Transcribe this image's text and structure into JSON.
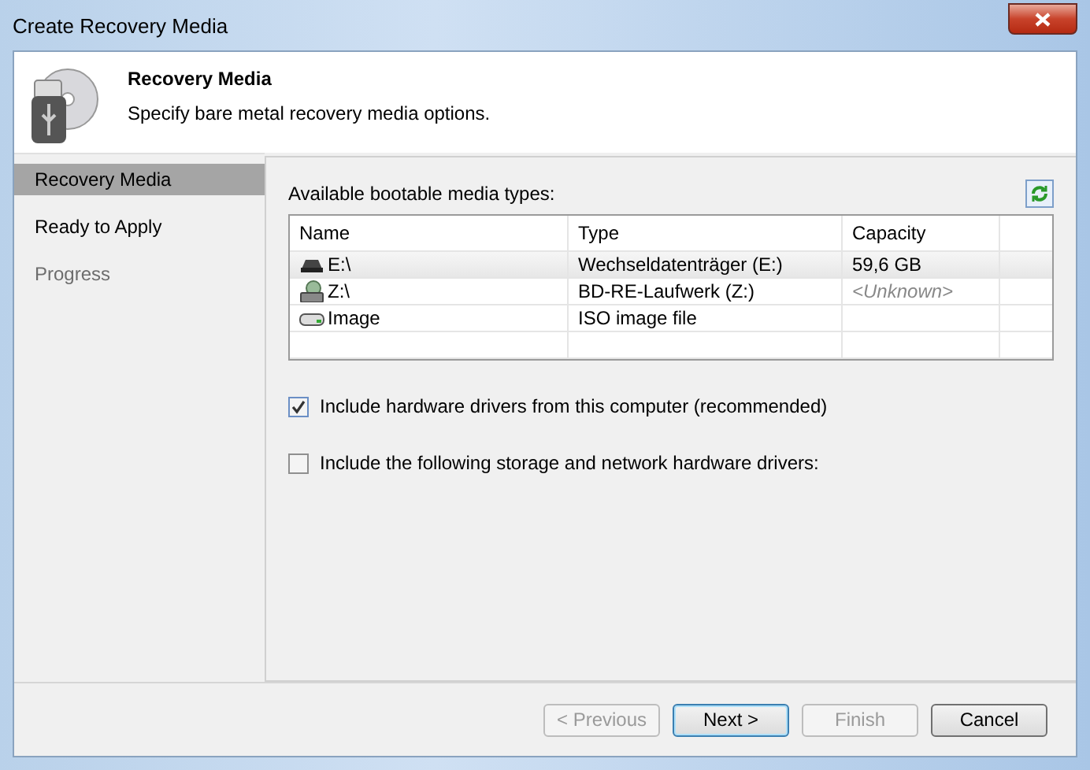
{
  "window": {
    "title": "Create Recovery Media"
  },
  "header": {
    "title": "Recovery Media",
    "subtitle": "Specify bare metal recovery media options."
  },
  "steps": [
    {
      "label": "Recovery Media",
      "selected": true,
      "disabled": false
    },
    {
      "label": "Ready to Apply",
      "selected": false,
      "disabled": false
    },
    {
      "label": "Progress",
      "selected": false,
      "disabled": true
    }
  ],
  "media": {
    "label": "Available bootable media types:",
    "columns": [
      "Name",
      "Type",
      "Capacity"
    ],
    "rows": [
      {
        "kind": "removable",
        "name": "E:\\",
        "type": "Wechseldatenträger (E:)",
        "capacity": "59,6 GB",
        "capacity_unknown": false,
        "selected": true
      },
      {
        "kind": "optical",
        "name": "Z:\\",
        "type": "BD-RE-Laufwerk (Z:)",
        "capacity": "<Unknown>",
        "capacity_unknown": true,
        "selected": false
      },
      {
        "kind": "image",
        "name": "Image",
        "type": "ISO image file",
        "selected": false
      }
    ]
  },
  "options": [
    {
      "label": "Include hardware drivers from this computer (recommended)",
      "checked": true
    },
    {
      "label": "Include the following storage and network hardware drivers:",
      "checked": false
    }
  ],
  "buttons": [
    {
      "label": "< Previous",
      "disabled": true,
      "default": false
    },
    {
      "label": "Next >",
      "disabled": false,
      "default": true
    },
    {
      "label": "Finish",
      "disabled": true,
      "default": false
    },
    {
      "label": "Cancel",
      "disabled": false,
      "default": false
    }
  ]
}
